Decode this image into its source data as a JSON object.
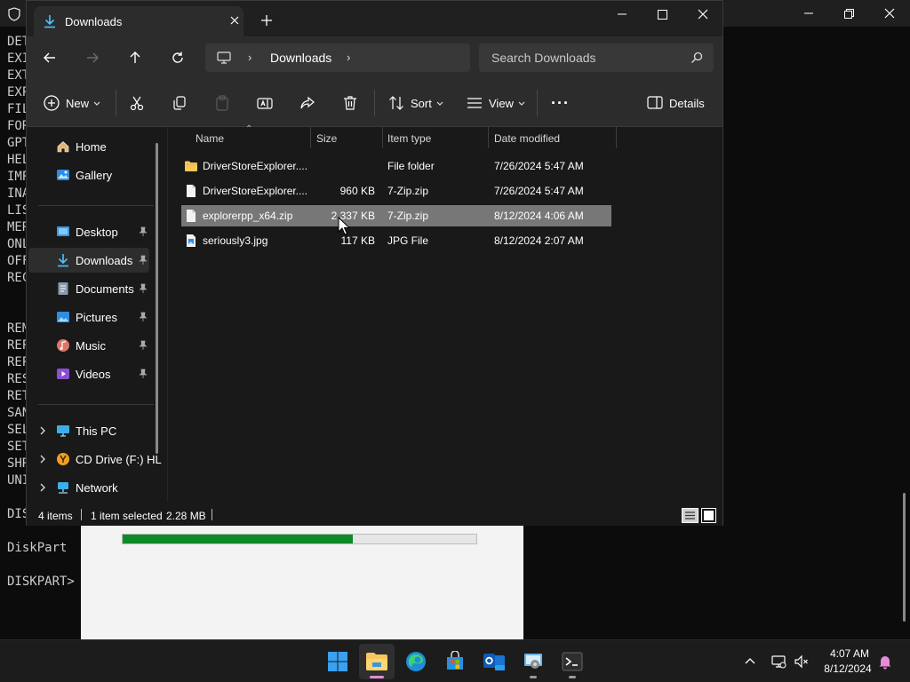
{
  "console": {
    "lines": [
      "DET",
      "EXI",
      "EXT",
      "EXP",
      "FIL",
      "FOR",
      "GPT",
      "HEL",
      "IMP",
      "INA",
      "LIS",
      "MER",
      "ONL",
      "OFF",
      "REC",
      "",
      "",
      "REM",
      "REP",
      "REP",
      "RES",
      "RET",
      "SAN",
      "SEL",
      "SET",
      "SHR",
      "UNI",
      "",
      "DISKPART>",
      "",
      "DiskPart",
      "",
      "DISKPART>"
    ]
  },
  "dialog": {
    "progress_fraction": 0.65
  },
  "explorer": {
    "tab_title": "Downloads",
    "address": {
      "location": "Downloads",
      "sep": "›"
    },
    "search_placeholder": "Search Downloads",
    "toolbar": {
      "new_label": "New",
      "sort_label": "Sort",
      "view_label": "View",
      "more_label": "···",
      "details_label": "Details"
    },
    "sidebar": {
      "home": "Home",
      "gallery": "Gallery",
      "desktop": "Desktop",
      "downloads": "Downloads",
      "documents": "Documents",
      "pictures": "Pictures",
      "music": "Music",
      "videos": "Videos",
      "this_pc": "This PC",
      "cd_drive": "CD Drive (F:) HL",
      "network": "Network"
    },
    "columns": {
      "name": "Name",
      "size": "Size",
      "type": "Item type",
      "modified": "Date modified"
    },
    "files": [
      {
        "name": "DriverStoreExplorer....",
        "size": "",
        "type": "File folder",
        "modified": "7/26/2024 5:47 AM"
      },
      {
        "name": "DriverStoreExplorer....",
        "size": "960 KB",
        "type": "7-Zip.zip",
        "modified": "7/26/2024 5:47 AM"
      },
      {
        "name": "explorerpp_x64.zip",
        "size": "2,337 KB",
        "type": "7-Zip.zip",
        "modified": "8/12/2024 4:06 AM"
      },
      {
        "name": "seriously3.jpg",
        "size": "117 KB",
        "type": "JPG File",
        "modified": "8/12/2024 2:07 AM"
      }
    ],
    "status": {
      "count": "4 items",
      "selection": "1 item selected",
      "selection_size": "2.28 MB"
    }
  },
  "taskbar": {
    "clock_time": "4:07 AM",
    "clock_date": "8/12/2024"
  },
  "colors": {
    "accent": "#4cc2ff",
    "folder": "#f8c75c",
    "selected_row": "#777777",
    "progress": "#0f8a28"
  }
}
